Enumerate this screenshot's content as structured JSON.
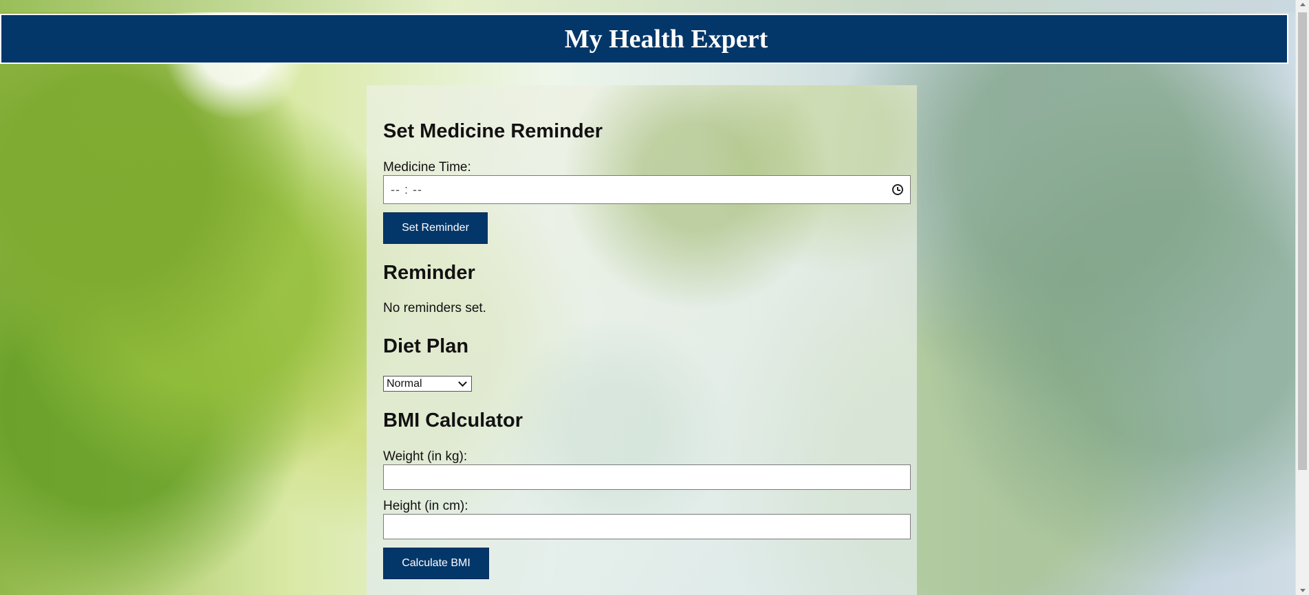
{
  "app": {
    "title": "My Health Expert"
  },
  "medicine_reminder": {
    "heading": "Set Medicine Reminder",
    "time_label": "Medicine Time:",
    "time_value": "-- : --",
    "button_label": "Set Reminder"
  },
  "reminder": {
    "heading": "Reminder",
    "status_text": "No reminders set."
  },
  "diet_plan": {
    "heading": "Diet Plan",
    "selected_option": "Normal"
  },
  "bmi_calculator": {
    "heading": "BMI Calculator",
    "weight_label": "Weight (in kg):",
    "weight_value": "",
    "height_label": "Height (in cm):",
    "height_value": "",
    "button_label": "Calculate BMI"
  },
  "theme": {
    "header_color": "#043769",
    "button_color": "#043769"
  },
  "icons": {
    "time_icon": "clock-icon",
    "select_icon": "chevron-down-icon",
    "scroll_up": "chevron-up-icon",
    "scroll_down": "chevron-down-icon"
  }
}
